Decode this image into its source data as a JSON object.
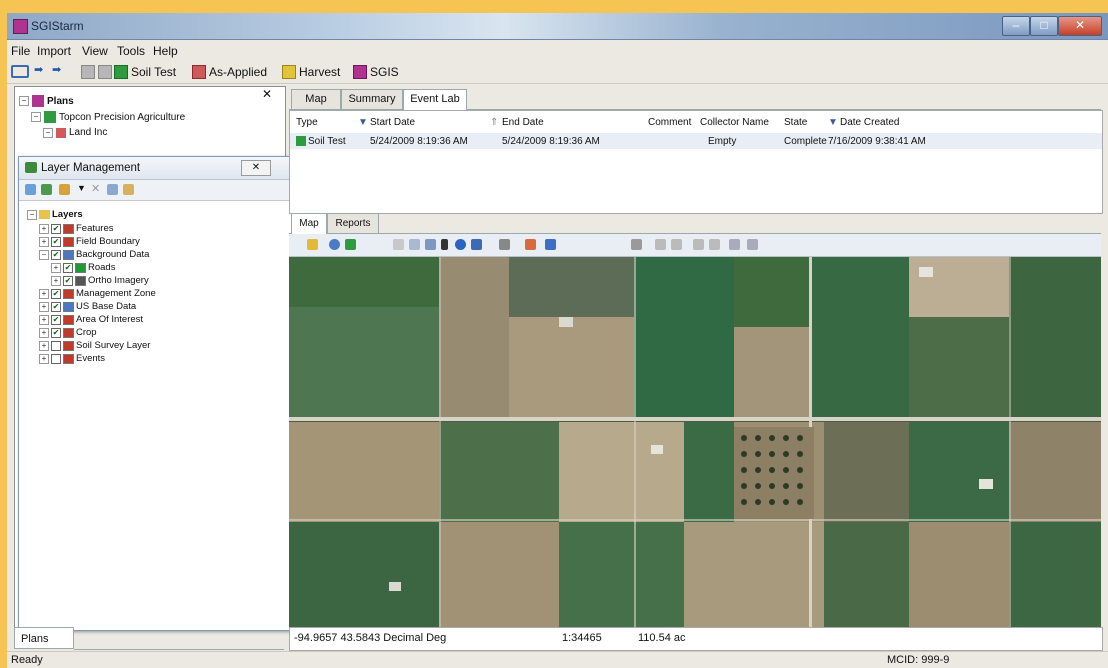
{
  "window": {
    "title": "SGIStarm"
  },
  "menu": [
    "File",
    "Import",
    "View",
    "Tools",
    "Help"
  ],
  "toolbar": {
    "soil_test": "Soil Test",
    "as_applied": "As-Applied",
    "harvest": "Harvest",
    "sgis": "SGIS"
  },
  "plans_tree": {
    "root": "Plans",
    "child": "Topcon Precision Agriculture",
    "grandchild": "Land Inc"
  },
  "layer_management": {
    "title": "Layer Management",
    "root": "Layers",
    "layers": [
      {
        "label": "Features",
        "checked": true,
        "color": "#c0392b"
      },
      {
        "label": "Field Boundary",
        "checked": true,
        "color": "#c0392b"
      },
      {
        "label": "Background Data",
        "checked": true,
        "color": "#4a78c2"
      },
      {
        "label": "Roads",
        "checked": true,
        "color": "#1e9a36"
      },
      {
        "label": "Ortho Imagery",
        "checked": true,
        "color": "#555555"
      },
      {
        "label": "Management Zone",
        "checked": true,
        "color": "#c0392b"
      },
      {
        "label": "US Base Data",
        "checked": true,
        "color": "#4a78c2"
      },
      {
        "label": "Area Of Interest",
        "checked": true,
        "color": "#c0392b"
      },
      {
        "label": "Crop",
        "checked": true,
        "color": "#c0392b"
      },
      {
        "label": "Soil Survey Layer",
        "checked": false,
        "color": "#c0392b"
      },
      {
        "label": "Events",
        "checked": false,
        "color": "#c0392b"
      }
    ]
  },
  "top_tabs": [
    "Map",
    "Summary",
    "Event Lab"
  ],
  "event_grid": {
    "headers": [
      "Type",
      "Start Date",
      "End Date",
      "Comment",
      "Collector Name",
      "State",
      "Date Created"
    ],
    "row": [
      "Soil Test",
      "5/24/2009 8:19:36 AM",
      "5/24/2009 8:19:36 AM",
      "",
      "Empty",
      "Complete",
      "7/16/2009 9:38:41 AM"
    ]
  },
  "map_tabs": [
    "Map",
    "Reports"
  ],
  "status": {
    "coords": "-94.9657 43.5843 Decimal Deg",
    "scale": "1:34465",
    "area": "110.54 ac"
  },
  "plans_tab": "Plans",
  "footer": {
    "ready": "Ready",
    "mcid": "MCID: 999-9"
  },
  "colors": {
    "accent": "#b0338f",
    "map_green": "#3e6d3c",
    "map_tan": "#9a8a6e"
  }
}
